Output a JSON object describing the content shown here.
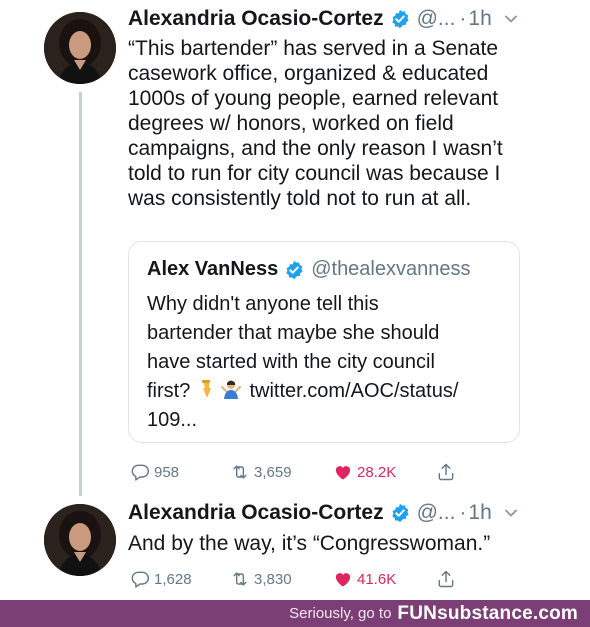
{
  "tweet1": {
    "author_name": "Alexandria Ocasio-Cortez",
    "handle": "@...",
    "separator": "·",
    "time": "1h",
    "text": "“This bartender” has served in a Senate\ncasework office, organized & educated\n1000s of young people, earned relevant\ndegrees w/ honors, worked on field\ncampaigns, and the only reason I wasn’t\ntold to run for city council was because I\nwas consistently told not to run at all.",
    "quoted": {
      "author_name": "Alex VanNess",
      "handle": "@thealexvanness",
      "text_before_emoji": "Why didn't anyone tell this\nbartender that maybe she should\nhave started with the city council\nfirst? ",
      "emojis": [
        "backhand-index-down",
        "person-shrugging"
      ],
      "link": "twitter.com/AOC/status/",
      "link_tail": "109..."
    },
    "replies": "958",
    "retweets": "3,659",
    "likes": "28.2K"
  },
  "tweet2": {
    "author_name": "Alexandria Ocasio-Cortez",
    "handle": "@...",
    "separator": "·",
    "time": "1h",
    "text": "And by the way, it’s “Congresswoman.”",
    "replies": "1,628",
    "retweets": "3,830",
    "likes": "41.6K"
  },
  "footer": {
    "text": "Seriously, go to",
    "brand": "FUNsubstance.com"
  },
  "colors": {
    "verified": "#1da1f2",
    "like": "#e0245e",
    "muted": "#657786",
    "footer_bg": "#7b3f76"
  },
  "icons": [
    "reply-icon",
    "retweet-icon",
    "heart-icon",
    "share-icon",
    "verified-icon",
    "chevron-down-icon"
  ]
}
